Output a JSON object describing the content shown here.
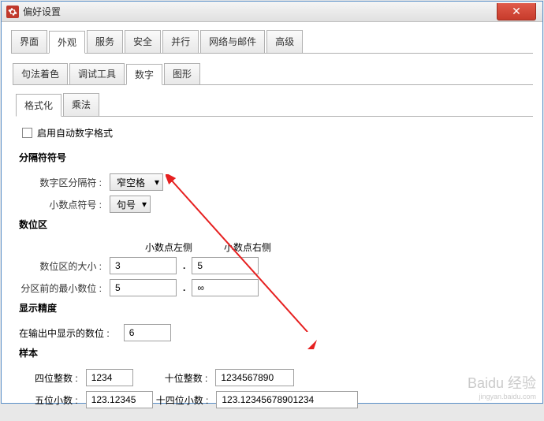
{
  "window": {
    "title": "偏好设置"
  },
  "tabs_main": {
    "items": [
      "界面",
      "外观",
      "服务",
      "安全",
      "并行",
      "网络与邮件",
      "高级"
    ],
    "active_index": 1
  },
  "tabs_sub": {
    "items": [
      "句法着色",
      "调试工具",
      "数字",
      "图形"
    ],
    "active_index": 2
  },
  "tabs_third": {
    "items": [
      "格式化",
      "乘法"
    ],
    "active_index": 0
  },
  "checkbox_auto": {
    "label": "启用自动数字格式"
  },
  "section_separator": {
    "title": "分隔符符号",
    "digit_separator": {
      "label": "数字区分隔符",
      "value": "窄空格"
    },
    "decimal_symbol": {
      "label": "小数点符号",
      "value": "句号"
    }
  },
  "section_digitzone": {
    "title": "数位区",
    "col_left": "小数点左侧",
    "col_right": "小数点右侧",
    "zone_size": {
      "label": "数位区的大小",
      "left": "3",
      "right": "5"
    },
    "min_digits": {
      "label": "分区前的最小数位",
      "left": "5",
      "right": "∞"
    }
  },
  "section_precision": {
    "title": "显示精度",
    "output_digits": {
      "label": "在输出中显示的数位",
      "value": "6"
    }
  },
  "section_sample": {
    "title": "样本",
    "four_int": {
      "label": "四位整数",
      "value": "1234"
    },
    "ten_int": {
      "label": "十位整数",
      "value": "1234567890"
    },
    "five_dec": {
      "label": "五位小数",
      "value": "123.12345"
    },
    "fourteen_dec": {
      "label": "十四位小数",
      "value": "123.12345678901234"
    }
  },
  "watermark": {
    "main": "Baidu 经验",
    "sub": "jingyan.baidu.com"
  }
}
